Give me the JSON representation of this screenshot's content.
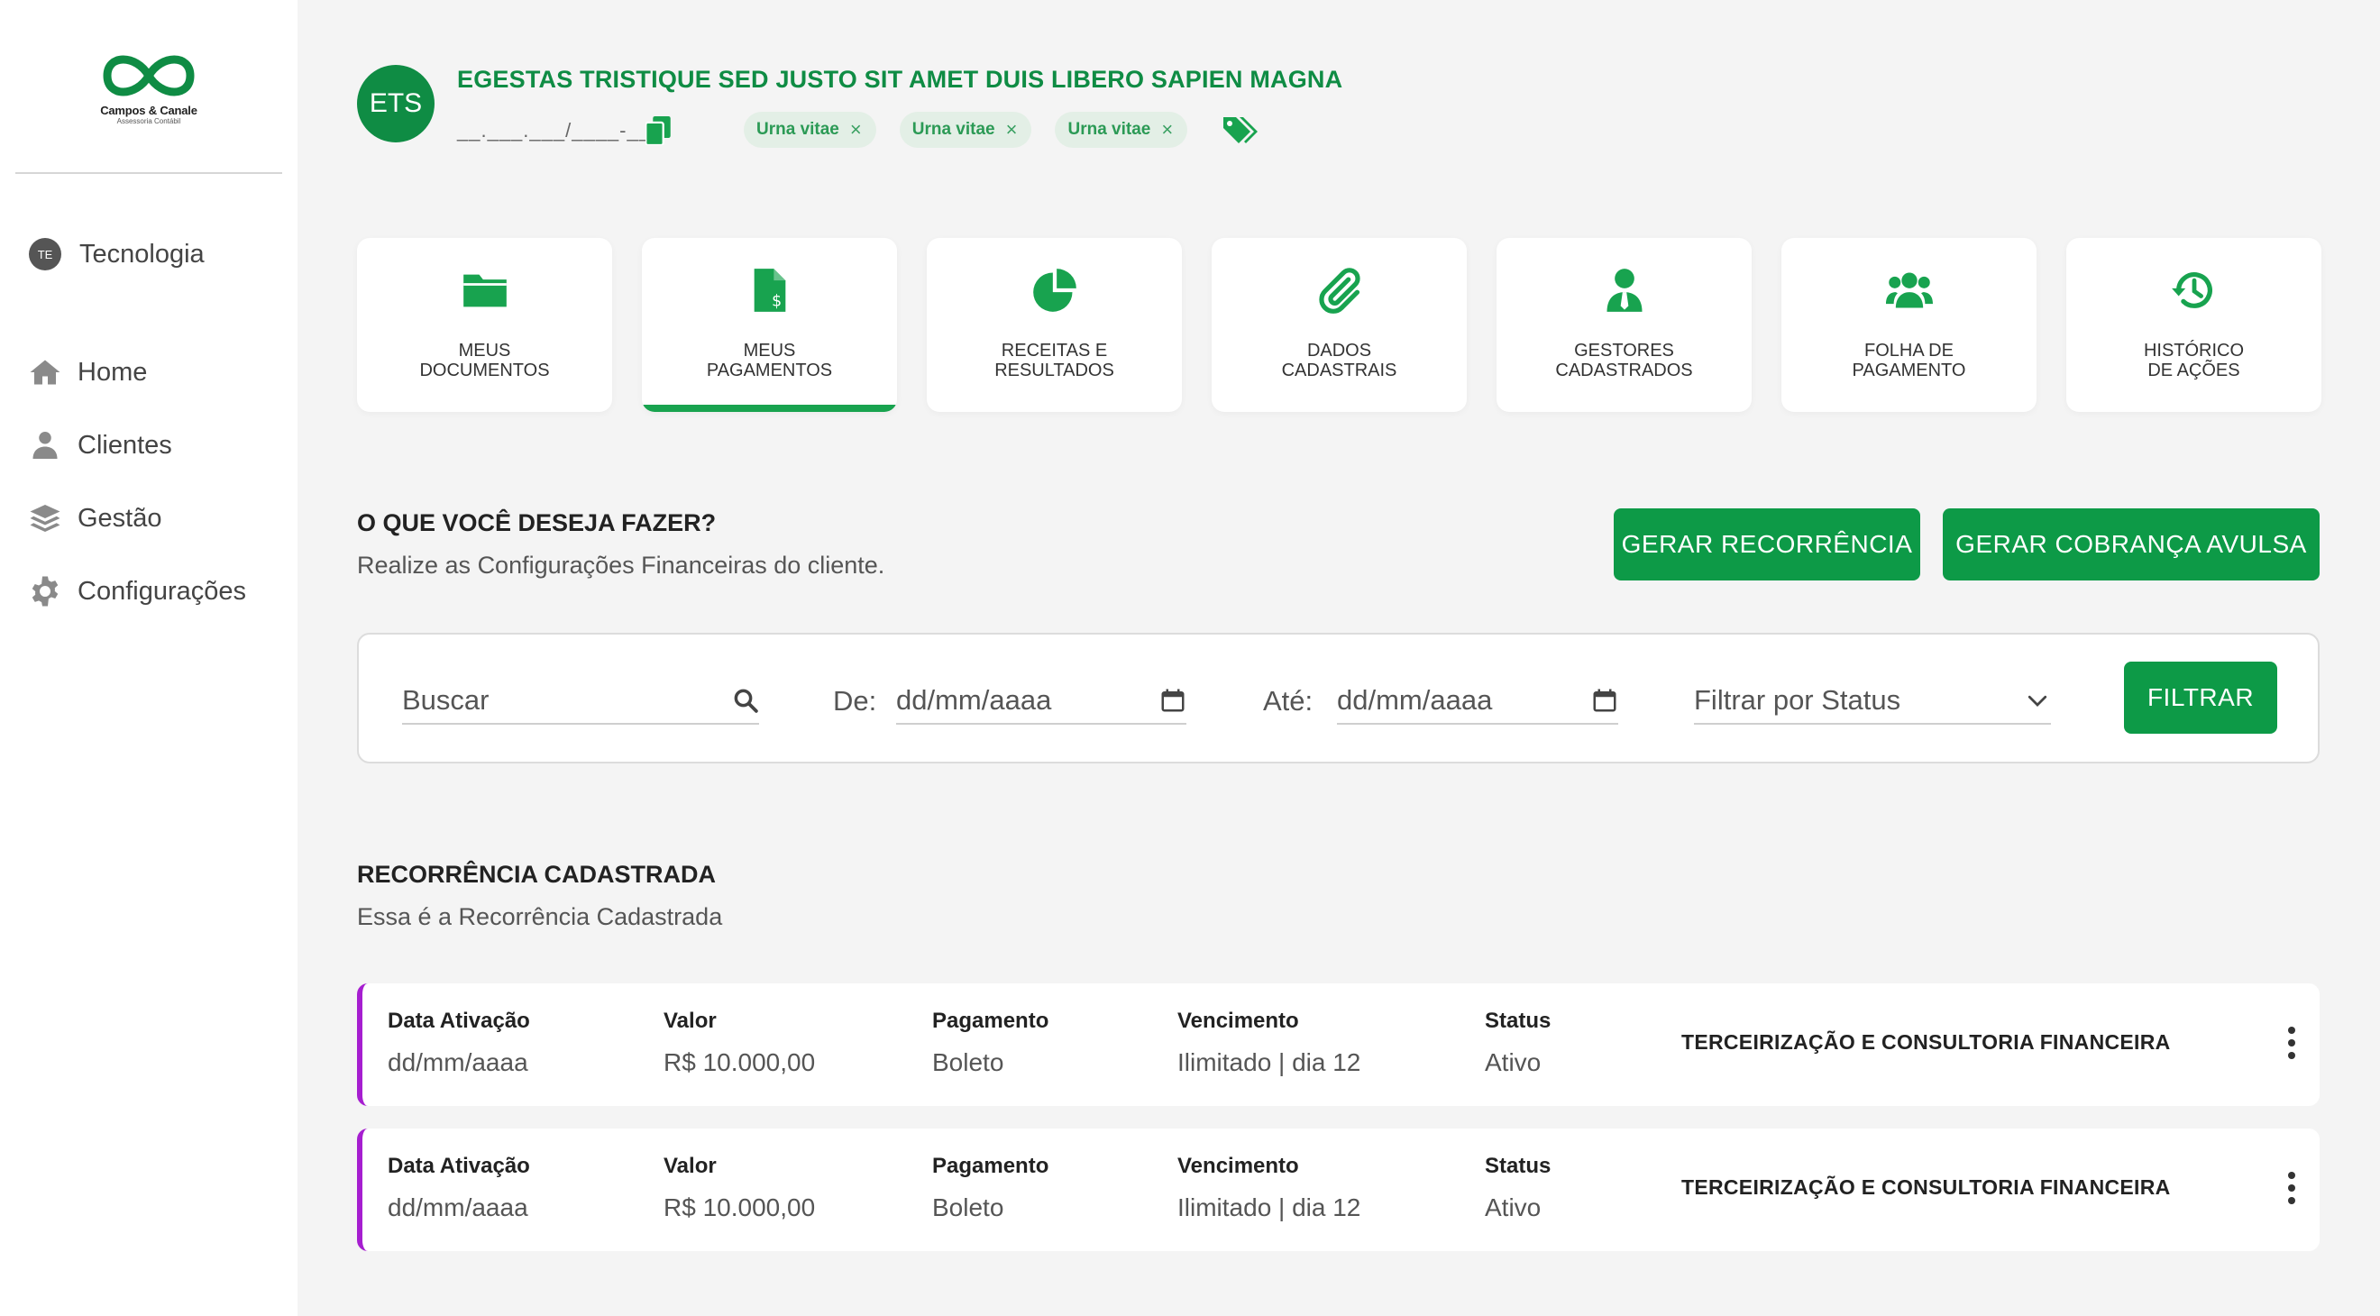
{
  "sidebar": {
    "logo": {
      "name": "Campos & Canale",
      "subtitle": "Assessoria Contábil"
    },
    "org": {
      "initials": "TE",
      "label": "Tecnologia"
    },
    "items": [
      {
        "label": "Home",
        "icon": "home-icon"
      },
      {
        "label": "Clientes",
        "icon": "user-icon"
      },
      {
        "label": "Gestão",
        "icon": "layers-icon"
      },
      {
        "label": "Configurações",
        "icon": "gear-icon"
      }
    ]
  },
  "header": {
    "avatar_initials": "ETS",
    "client_name": "EGESTAS TRISTIQUE SED JUSTO SIT AMET DUIS LIBERO SAPIEN MAGNA",
    "document": "__.___.___/____-__",
    "tags": [
      {
        "label": "Urna vitae",
        "remove": "×"
      },
      {
        "label": "Urna vitae",
        "remove": "×"
      },
      {
        "label": "Urna vitae",
        "remove": "×"
      }
    ]
  },
  "cards": [
    {
      "label": "MEUS\nDOCUMENTOS",
      "icon": "folder-icon"
    },
    {
      "label": "MEUS\nPAGAMENTOS",
      "icon": "invoice-dollar-icon",
      "active": true
    },
    {
      "label": "RECEITAS E\nRESULTADOS",
      "icon": "pie-chart-icon"
    },
    {
      "label": "DADOS\nCADASTRAIS",
      "icon": "paperclip-icon"
    },
    {
      "label": "GESTORES\nCADASTRADOS",
      "icon": "user-tie-icon"
    },
    {
      "label": "FOLHA DE\nPAGAMENTO",
      "icon": "users-icon"
    },
    {
      "label": "HISTÓRICO\nDE AÇÕES",
      "icon": "history-icon"
    }
  ],
  "actions": {
    "title": "O QUE VOCÊ DESEJA FAZER?",
    "subtitle": "Realize as Configurações Financeiras do cliente.",
    "btn_recurrence": "GERAR RECORRÊNCIA",
    "btn_single": "GERAR COBRANÇA AVULSA"
  },
  "filter": {
    "search_placeholder": "Buscar",
    "from_label": "De:",
    "from_value": "dd/mm/aaaa",
    "to_label": "Até:",
    "to_value": "dd/mm/aaaa",
    "status_placeholder": "Filtrar por Status",
    "button": "FILTRAR"
  },
  "recurrence": {
    "title": "RECORRÊNCIA CADASTRADA",
    "subtitle": "Essa é a Recorrência Cadastrada",
    "headers": {
      "activation": "Data Ativação",
      "value": "Valor",
      "payment": "Pagamento",
      "due": "Vencimento",
      "status": "Status"
    },
    "rows": [
      {
        "activation": "dd/mm/aaaa",
        "value": "R$ 10.000,00",
        "payment": "Boleto",
        "due": "Ilimitado | dia 12",
        "status": "Ativo",
        "service": "TERCEIRIZAÇÃO E CONSULTORIA FINANCEIRA"
      },
      {
        "activation": "dd/mm/aaaa",
        "value": "R$ 10.000,00",
        "payment": "Boleto",
        "due": "Ilimitado | dia 12",
        "status": "Ativo",
        "service": "TERCEIRIZAÇÃO E CONSULTORIA FINANCEIRA"
      }
    ]
  },
  "colors": {
    "brand_green": "#0d9a47",
    "record_accent": "#a61ed0",
    "sidebar_bg": "#ffffff",
    "page_bg": "#f4f4f4"
  }
}
